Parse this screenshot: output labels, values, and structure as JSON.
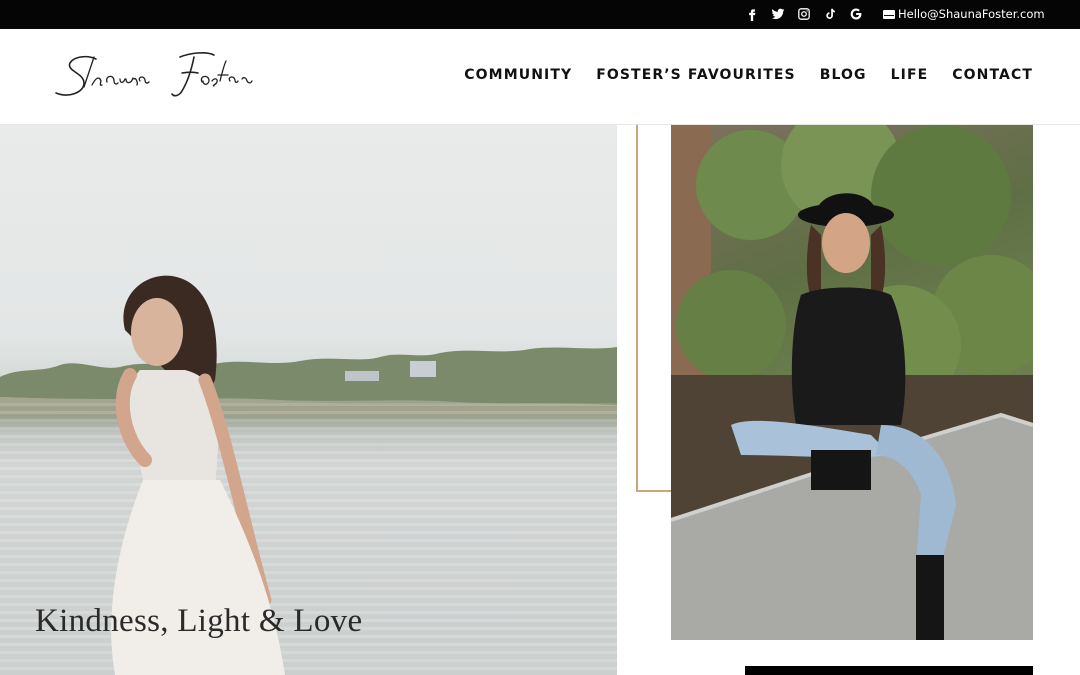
{
  "topbar": {
    "social_icons": [
      "facebook-icon",
      "twitter-icon",
      "instagram-icon",
      "tiktok-icon",
      "google-icon"
    ],
    "email": "Hello@ShaunaFoster.com"
  },
  "header": {
    "logo_text": "Shauna Foster",
    "nav": [
      "COMMUNITY",
      "FOSTER’S FAVOURITES",
      "BLOG",
      "LIFE",
      "CONTACT"
    ]
  },
  "hero": {
    "title": "Kindness, Light & Love"
  },
  "colors": {
    "topbar": "#050505",
    "accent_gold": "#c7a77d",
    "text": "#111111"
  }
}
